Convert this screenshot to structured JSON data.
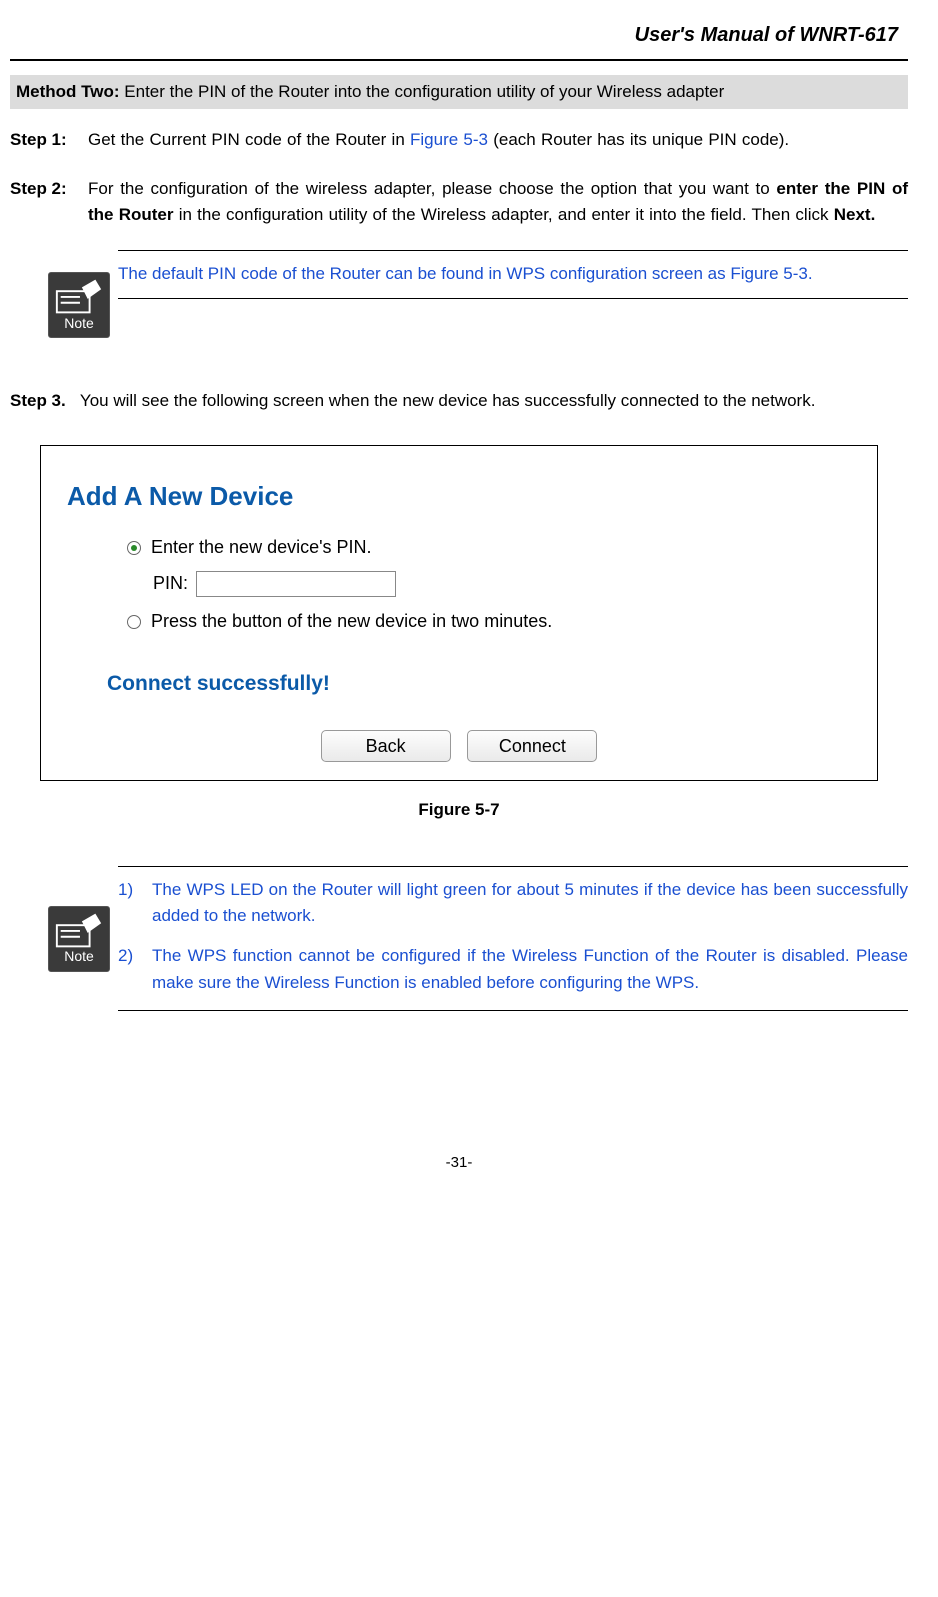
{
  "header": {
    "title": "User's Manual of WNRT-617"
  },
  "method_bar": {
    "label": "Method Two:",
    "text": " Enter the PIN of the Router into the configuration utility of your Wireless adapter"
  },
  "step1": {
    "label": "Step 1:",
    "prefix": "Get the Current PIN code of the Router in ",
    "link": "Figure 5-3",
    "suffix": " (each Router has its unique PIN code)."
  },
  "step2": {
    "label": "Step 2:",
    "prefix": "For the configuration of the wireless adapter, please choose the option that you want to ",
    "bold1": "enter the PIN of the Router",
    "mid": " in the configuration utility of the Wireless adapter, and enter it into the field. Then click ",
    "bold2": "Next."
  },
  "note1": {
    "icon_label": "Note",
    "text": "The default PIN code of the Router can be found in WPS configuration screen as Figure 5-3."
  },
  "step3": {
    "label": "Step 3.",
    "text": "You will see the following screen when the new device has successfully connected to the network."
  },
  "figure": {
    "title": "Add A New Device",
    "opt1": "Enter the new device's PIN.",
    "pin_label": "PIN:",
    "opt2": "Press the button of the new device in two minutes.",
    "success": "Connect successfully!",
    "back_btn": "Back",
    "connect_btn": "Connect",
    "caption": "Figure 5-7"
  },
  "note2": {
    "icon_label": "Note",
    "item1_num": "1)",
    "item1_text": "The WPS LED on the Router will light green for about 5 minutes if the device has been successfully added to the network.",
    "item2_num": "2)",
    "item2_text": "The WPS function cannot be configured if the Wireless Function of the Router is disabled. Please make sure the Wireless Function is enabled before configuring the WPS."
  },
  "page_number": "-31-"
}
